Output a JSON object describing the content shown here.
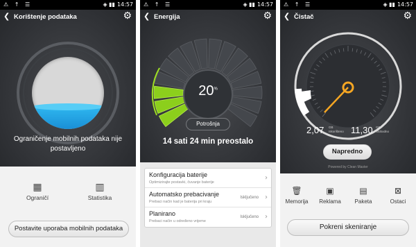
{
  "status": {
    "left_icons": "⚠ ↑ ☰",
    "right_icons": "◈ ▮▮",
    "time": "14:57"
  },
  "screen1": {
    "title": "Korištenje podataka",
    "usage_fill_percent": 32,
    "message": "Ograničenje mobilnih podataka nije postavljeno",
    "btn_limits": "Ograničí",
    "btn_stats": "Statistika",
    "action_button": "Postavite uporaba mobilnih podataka",
    "colors": {
      "water": "#2fb8f0"
    }
  },
  "screen2": {
    "title": "Energija",
    "battery_percent": "20",
    "percent_sign": "%",
    "usage_button": "Potrošnja",
    "remaining": "14 sati 24 min  preostalo",
    "rows": [
      {
        "title": "Konfiguracija baterije",
        "subtitle": "Optimizirajte postavki, čuvanje baterije",
        "value": ""
      },
      {
        "title": "Automatsko prebacivanje",
        "subtitle": "Prebaci način kad je baterija pri kraju",
        "value": "Isključeno"
      },
      {
        "title": "Planirano",
        "subtitle": "Prebaci način u određeno vrijeme",
        "value": "Isključeno"
      }
    ],
    "colors": {
      "green": "#8ccf1c"
    }
  },
  "screen3": {
    "title": "Čistač",
    "mem_used": "2,07",
    "mem_used_unit": "GB",
    "mem_used_label": "Iskorišteno",
    "mem_free": "11,30",
    "mem_free_unit": "GB",
    "mem_free_label": "Slobodno",
    "advanced_button": "Napredno",
    "powered_by": "Powered by Clean Master",
    "buttons": [
      "Memorija",
      "Reklama",
      "Paketa",
      "Ostaci"
    ],
    "scan_button": "Pokreni skeniranje",
    "colors": {
      "accent": "#f5a623"
    }
  }
}
